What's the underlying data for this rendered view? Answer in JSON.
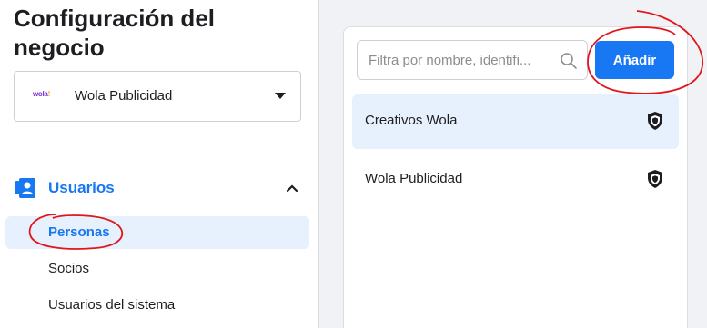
{
  "page": {
    "title": "Configuración del negocio"
  },
  "business_selector": {
    "logo_text": "wola",
    "logo_dot": "!",
    "value": "Wola Publicidad"
  },
  "sidebar": {
    "section_label": "Usuarios",
    "items": [
      {
        "label": "Personas",
        "active": true
      },
      {
        "label": "Socios",
        "active": false
      },
      {
        "label": "Usuarios del sistema",
        "active": false
      }
    ]
  },
  "main": {
    "search": {
      "placeholder": "Filtra por nombre, identifi..."
    },
    "add_label": "Añadir",
    "list": [
      {
        "label": "Creativos Wola",
        "selected": true
      },
      {
        "label": "Wola Publicidad",
        "selected": false
      }
    ]
  },
  "colors": {
    "accent": "#1877f2",
    "annotation": "#e0161b",
    "selected_bg": "#e7f0fd"
  }
}
